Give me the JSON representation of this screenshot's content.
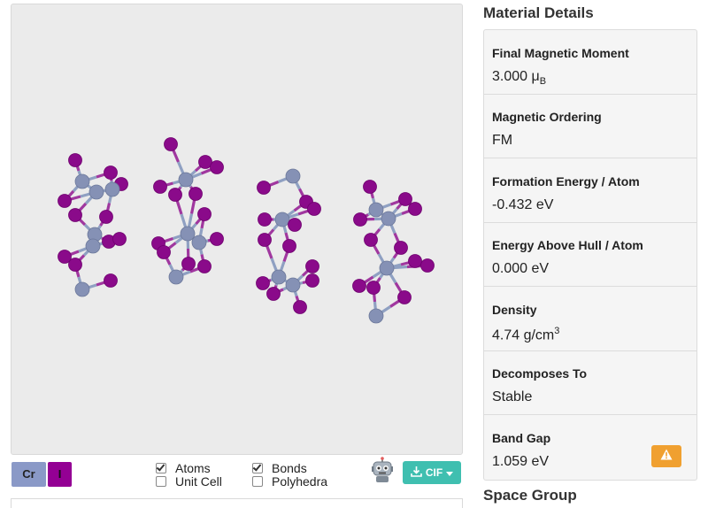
{
  "viewer": {
    "legend": [
      {
        "symbol": "Cr",
        "color": "#8a99c7"
      },
      {
        "symbol": "I",
        "color": "#940094"
      }
    ],
    "options": {
      "atoms": {
        "label": "Atoms",
        "checked": true
      },
      "bonds": {
        "label": "Bonds",
        "checked": true
      },
      "unit_cell": {
        "label": "Unit Cell",
        "checked": false
      },
      "polyhedra": {
        "label": "Polyhedra",
        "checked": false
      }
    },
    "download_label": "CIF",
    "colors": {
      "chromium": "#8591b5",
      "iodine": "#8a0a8a",
      "background": "#ebebeb"
    }
  },
  "sidebar": {
    "title": "Material Details",
    "properties": [
      {
        "label": "Final Magnetic Moment",
        "value": "3.000 μ",
        "sub": "B"
      },
      {
        "label": "Magnetic Ordering",
        "value": "FM"
      },
      {
        "label": "Formation Energy / Atom",
        "value": "-0.432 eV"
      },
      {
        "label": "Energy Above Hull / Atom",
        "value": "0.000 eV"
      },
      {
        "label": "Density",
        "value": "4.74 g/cm",
        "sup": "3"
      },
      {
        "label": "Decomposes To",
        "value": "Stable"
      },
      {
        "label": "Band Gap",
        "value": "1.059 eV"
      }
    ],
    "next_section_title": "Space Group"
  }
}
